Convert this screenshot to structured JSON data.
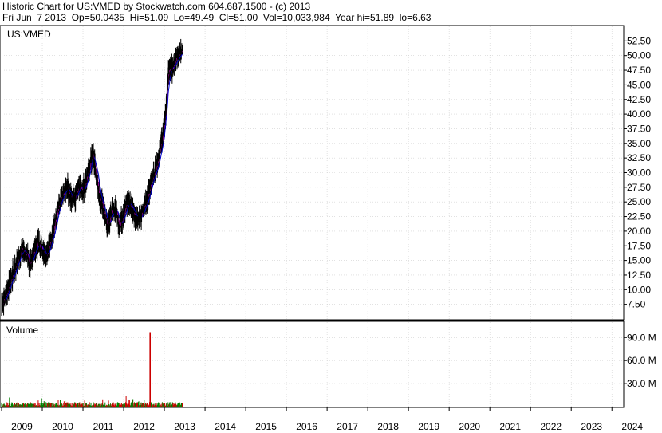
{
  "header": {
    "line1": "Historic Chart for US:VMED by Stockwatch.com 604.687.1500 - (c) 2013",
    "line2": "Fri Jun  7 2013  Op=50.0435  Hi=51.09  Lo=49.49  Cl=51.00  Vol=10,033,984  Year hi=51.89  lo=6.63"
  },
  "price_panel": {
    "label": "US:VMED"
  },
  "volume_panel": {
    "label": "Volume"
  },
  "colors": {
    "price": "#000000",
    "ma_short": "#cc00cc",
    "ma_long": "#0000cc",
    "vol_up": "#008000",
    "vol_down": "#cc0000",
    "frame": "#000000",
    "grid": "#d0d0d0"
  },
  "chart_data": [
    {
      "type": "line",
      "title": "US:VMED",
      "ylim": [
        5,
        55
      ],
      "y_ticks": [
        "7.50",
        "10.00",
        "12.50",
        "15.00",
        "17.50",
        "20.00",
        "22.50",
        "25.00",
        "27.50",
        "30.00",
        "32.50",
        "35.00",
        "37.50",
        "40.00",
        "42.50",
        "45.00",
        "47.50",
        "50.00",
        "52.50"
      ],
      "x_ticks": [
        "2009",
        "2010",
        "2011",
        "2012",
        "2013",
        "2014",
        "2015",
        "2016",
        "2017",
        "2018",
        "2019",
        "2020",
        "2021",
        "2022",
        "2023",
        "2024"
      ],
      "xlim": [
        2009.0,
        2024.27
      ],
      "series": [
        {
          "x": [
            2009.0,
            2009.1,
            2009.2,
            2009.3,
            2009.4,
            2009.5,
            2009.6,
            2009.7,
            2009.8,
            2009.9,
            2010.0,
            2010.1,
            2010.2,
            2010.3,
            2010.4,
            2010.5,
            2010.6,
            2010.7,
            2010.8,
            2010.9,
            2011.0,
            2011.1,
            2011.2,
            2011.25,
            2011.3,
            2011.4,
            2011.5,
            2011.6,
            2011.7,
            2011.8,
            2011.9,
            2012.0,
            2012.1,
            2012.2,
            2012.3,
            2012.4,
            2012.5,
            2012.6,
            2012.7,
            2012.8,
            2012.9,
            2013.0,
            2013.05,
            2013.1,
            2013.2,
            2013.3,
            2013.44
          ],
          "values": [
            7.5,
            9.0,
            11.0,
            13.0,
            15.0,
            17.0,
            16.0,
            14.5,
            16.5,
            18.0,
            17.0,
            16.0,
            18.0,
            21.0,
            24.0,
            26.0,
            27.5,
            26.0,
            25.5,
            28.0,
            27.0,
            29.0,
            32.0,
            33.0,
            31.0,
            26.0,
            24.0,
            21.0,
            23.0,
            24.0,
            21.0,
            23.0,
            25.0,
            24.0,
            22.5,
            22.0,
            24.0,
            26.0,
            29.0,
            31.0,
            34.0,
            38.0,
            41.0,
            47.0,
            48.0,
            50.0,
            51.0
          ]
        }
      ]
    },
    {
      "type": "bar",
      "title": "Volume",
      "ylim": [
        0,
        110
      ],
      "y_ticks": [
        "30.0 M",
        "60.0 M",
        "90.0 M"
      ],
      "series": [
        {
          "name": "Volume",
          "x": [
            2012.65
          ],
          "values": [
            97
          ]
        }
      ]
    }
  ]
}
